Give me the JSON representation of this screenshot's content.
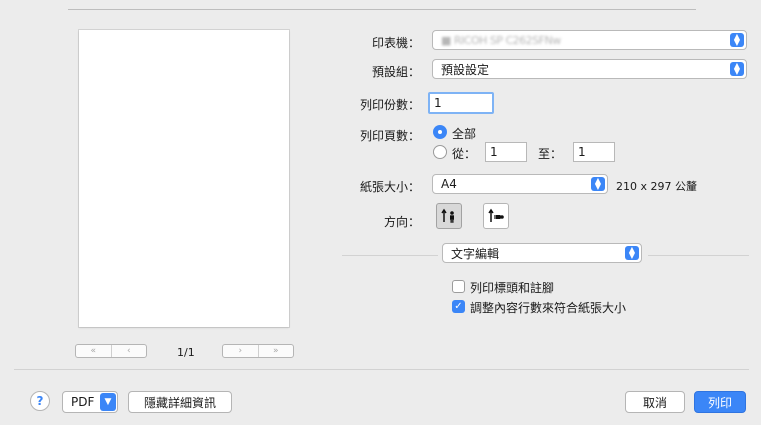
{
  "preview": {
    "first_icon": "«",
    "prev_icon": "‹",
    "next_icon": "›",
    "last_icon": "»",
    "page_indicator": "1/1"
  },
  "printer": {
    "label": "印表機：",
    "value": "■ RICOH SP C262SFNw"
  },
  "presets": {
    "label": "預設組：",
    "value": "預設設定"
  },
  "copies": {
    "label": "列印份數：",
    "value": "1"
  },
  "pages": {
    "label": "列印頁數：",
    "all_label": "全部",
    "from_label": "從：",
    "from_value": "1",
    "to_label": "至：",
    "to_value": "1"
  },
  "paper": {
    "label": "紙張大小：",
    "value": "A4",
    "dimensions": "210 x 297 公釐"
  },
  "orientation": {
    "label": "方向："
  },
  "section": {
    "value": "文字編輯"
  },
  "options": {
    "headers_footers": {
      "label": "列印標頭和註腳",
      "checked": false
    },
    "rewrap": {
      "label": "調整內容行數來符合紙張大小",
      "checked": true
    }
  },
  "footer": {
    "help": "?",
    "pdf": "PDF",
    "hide_details": "隱藏詳細資訊",
    "cancel": "取消",
    "print": "列印"
  },
  "colors": {
    "accent": "#3b86f7",
    "background": "#ececec"
  }
}
